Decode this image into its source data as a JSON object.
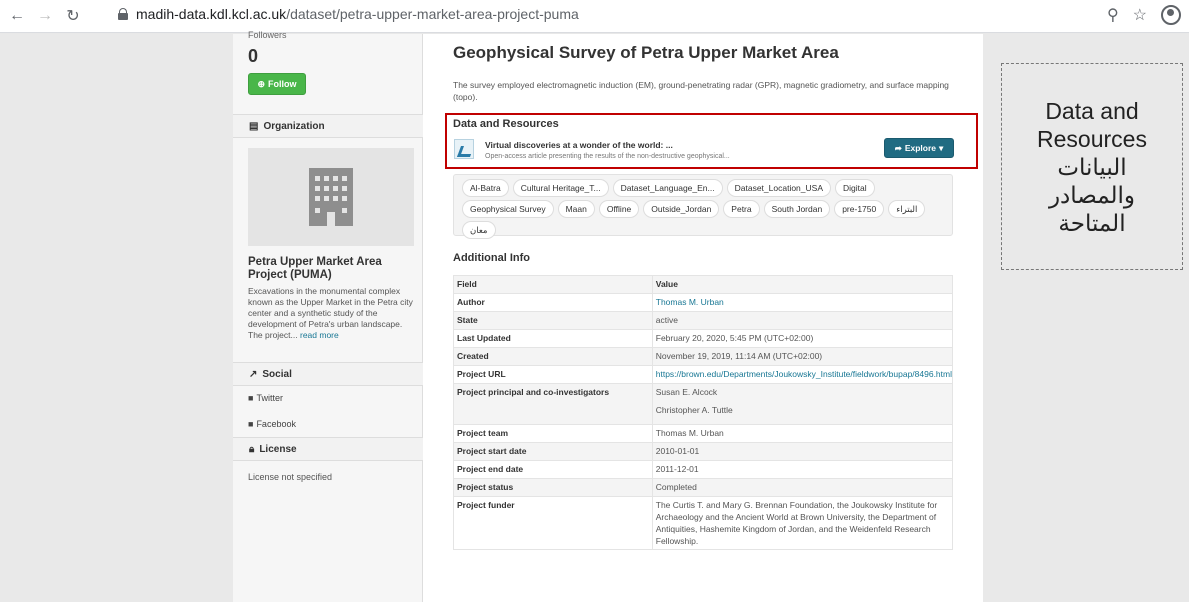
{
  "browser": {
    "url_host": "madih-data.kdl.kcl.ac.uk",
    "url_path": "/dataset/petra-upper-market-area-project-puma"
  },
  "sidebar": {
    "followers_label": "Followers",
    "followers_count": "0",
    "follow_button": "Follow",
    "organization_header": "Organization",
    "org_title": "Petra Upper Market Area Project (PUMA)",
    "org_description": "Excavations in the monumental complex known as the Upper Market in the Petra city center and a synthetic study of the development of Petra's urban landscape. The project...",
    "read_more": "read more",
    "social_header": "Social",
    "twitter": "Twitter",
    "facebook": "Facebook",
    "license_header": "License",
    "license_text": "License not specified"
  },
  "main": {
    "title": "Geophysical Survey of Petra Upper Market Area",
    "description": "The survey employed electromagnetic induction (EM), ground-penetrating radar (GPR), magnetic gradiometry, and surface mapping (topo).",
    "resources_header": "Data and Resources",
    "resource_title": "Virtual discoveries at a wonder of the world: ...",
    "resource_desc": "Open-access article presenting the results of the non-destructive geophysical...",
    "explore_button": "Explore",
    "tags": [
      "Al-Batra",
      "Cultural Heritage_T...",
      "Dataset_Language_En...",
      "Dataset_Location_USA",
      "Digital",
      "Geophysical Survey",
      "Maan",
      "Offline",
      "Outside_Jordan",
      "Petra",
      "South Jordan",
      "pre-1750",
      "البتراء",
      "معان"
    ],
    "additional_info_header": "Additional Info",
    "table_header": {
      "field": "Field",
      "value": "Value"
    },
    "rows": [
      {
        "field": "Author",
        "value": "Thomas M. Urban"
      },
      {
        "field": "State",
        "value": "active"
      },
      {
        "field": "Last Updated",
        "value": "February 20, 2020, 5:45 PM (UTC+02:00)"
      },
      {
        "field": "Created",
        "value": "November 19, 2019, 11:14 AM (UTC+02:00)"
      },
      {
        "field": "Project URL",
        "value": "https://brown.edu/Departments/Joukowsky_Institute/fieldwork/bupap/8496.html"
      },
      {
        "field": "Project principal and co-investigators",
        "value": "Susan E. Alcock",
        "value2": "Christopher A. Tuttle"
      },
      {
        "field": "Project team",
        "value": "Thomas M. Urban"
      },
      {
        "field": "Project start date",
        "value": "2010-01-01"
      },
      {
        "field": "Project end date",
        "value": "2011-12-01"
      },
      {
        "field": "Project status",
        "value": "Completed"
      },
      {
        "field": "Project funder",
        "value": "The Curtis T. and Mary G. Brennan Foundation, the Joukowsky Institute for Archaeology and the Ancient World at Brown University, the Department of Antiquities, Hashemite Kingdom of Jordan, and the Weidenfeld Research Fellowship."
      }
    ]
  },
  "annotation": {
    "line1": "Data and",
    "line2": "Resources",
    "line3": "البيانات",
    "line4": "والمصادر",
    "line5": "المتاحة"
  },
  "colors": {
    "accent": "#206b82",
    "follow": "#49b649",
    "highlight": "#c00000",
    "link": "#187794"
  }
}
